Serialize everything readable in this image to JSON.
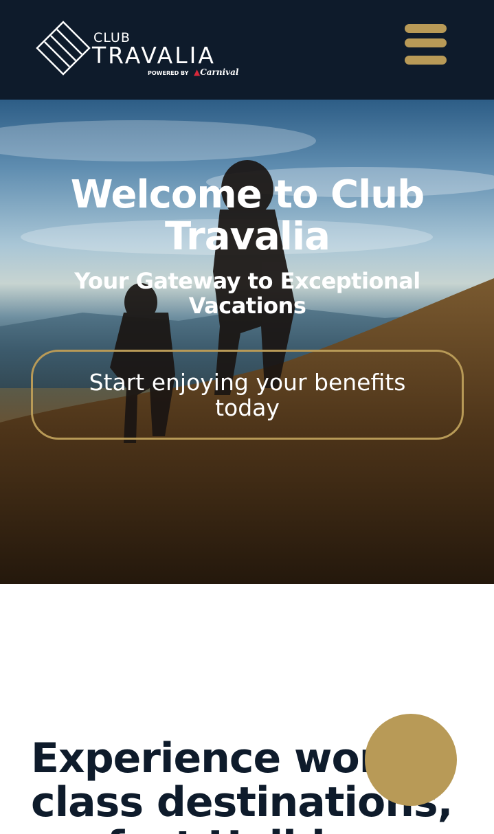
{
  "header": {
    "logo": {
      "club": "CLUB",
      "travalia": "TRAVALIA",
      "powered_by": "POWERED BY",
      "carnival": "Carnival"
    },
    "menu_icon": "hamburger-menu-icon"
  },
  "hero": {
    "title": "Welcome to Club Travalia",
    "subtitle": "Your Gateway to Exceptional Vacations",
    "cta_label": "Start enjoying your benefits today"
  },
  "section": {
    "heading": "Experience world class destinations, perfect Holidays"
  },
  "colors": {
    "navy": "#0e1b2b",
    "gold": "#b89a57",
    "white": "#ffffff"
  }
}
